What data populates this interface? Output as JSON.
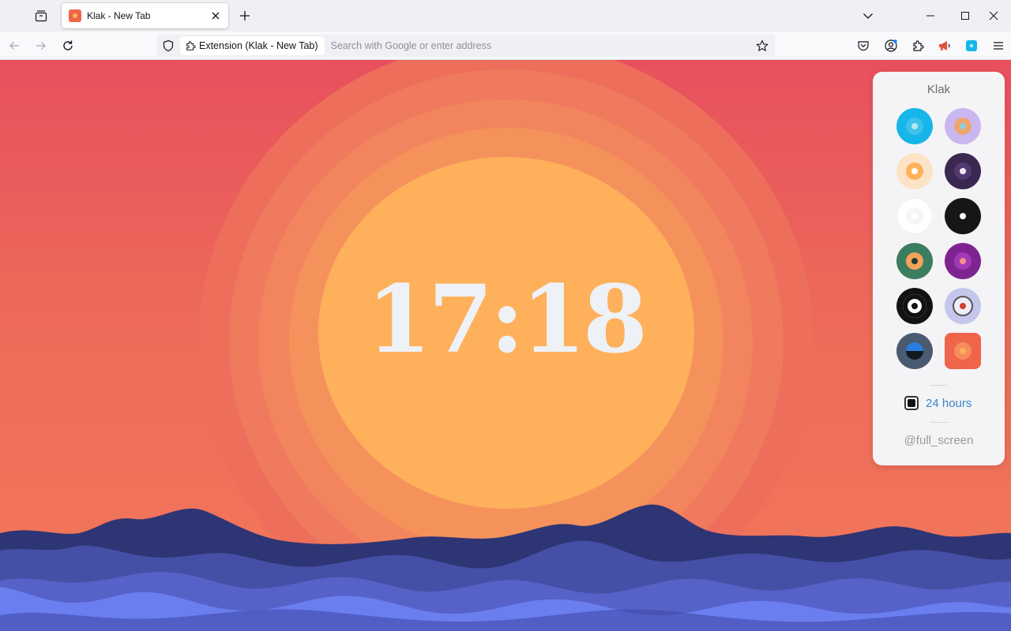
{
  "browser": {
    "tab": {
      "title": "Klak - New Tab"
    },
    "urlbar": {
      "extension_chip": "Extension (Klak - New Tab)",
      "placeholder": "Search with Google or enter address"
    },
    "icons": [
      "tab-list-icon",
      "close-icon",
      "plus-icon",
      "chevron-down-icon",
      "minimize-icon",
      "maximize-icon",
      "close-window-icon",
      "back-arrow-icon",
      "forward-arrow-icon",
      "reload-icon",
      "shield-icon",
      "puzzle-icon",
      "star-icon",
      "pocket-icon",
      "account-icon",
      "extensions-icon",
      "megaphone-icon",
      "klak-extension-icon",
      "menu-icon"
    ]
  },
  "clock": {
    "time": "17:18"
  },
  "scene": {
    "sky_top": "#e8505d",
    "sky_bottom": "#f2785a",
    "sun": "#feb05b",
    "mountains": [
      "#2e3574",
      "#454fa6",
      "#5662c8",
      "#6a7ef0"
    ]
  },
  "panel": {
    "title": "Klak",
    "themes": [
      {
        "name": "blue-sky",
        "outer": "#17b6ea",
        "mid": "#3ec2ea",
        "dot": "#b4e9f7"
      },
      {
        "name": "lavender",
        "outer": "#cab7f0",
        "mid": "#f0a56e",
        "dot": "#8fd0d8"
      },
      {
        "name": "cream",
        "outer": "#fde3c6",
        "mid": "#feb05b",
        "dot": "#fffdf5"
      },
      {
        "name": "plum-night",
        "outer": "#3a2850",
        "mid": "#54396f",
        "dot": "#f2e8f4"
      },
      {
        "name": "white",
        "outer": "#ffffff",
        "mid": "#f6f6f6",
        "dot": "#ffffff"
      },
      {
        "name": "black",
        "outer": "#161616",
        "mid": "#161616",
        "dot": "#ffffff"
      },
      {
        "name": "forest",
        "outer": "#3b7d5f",
        "mid": "#f4a35a",
        "dot": "#1f3f32"
      },
      {
        "name": "purple",
        "outer": "#7e2491",
        "mid": "#a23ab7",
        "dot": "#f58f7f"
      },
      {
        "name": "bullseye",
        "outer": "#121212",
        "mid": "#ffffff",
        "dot": "#121212"
      },
      {
        "name": "periwinkle",
        "outer": "#c4c6ec",
        "mid": "#eeeef9",
        "dot": "#d0412f"
      },
      {
        "name": "ocean-night",
        "outer": "#4a5a70",
        "mid": "#2a7de0",
        "dot": "#1e2a3a"
      },
      {
        "name": "sunset",
        "outer": "#f0644a",
        "mid": "#f68b5b",
        "dot": "#feb05b"
      }
    ],
    "hours_label": "24 hours",
    "hours_checked": true,
    "fullscreen_label": "@full_screen"
  }
}
